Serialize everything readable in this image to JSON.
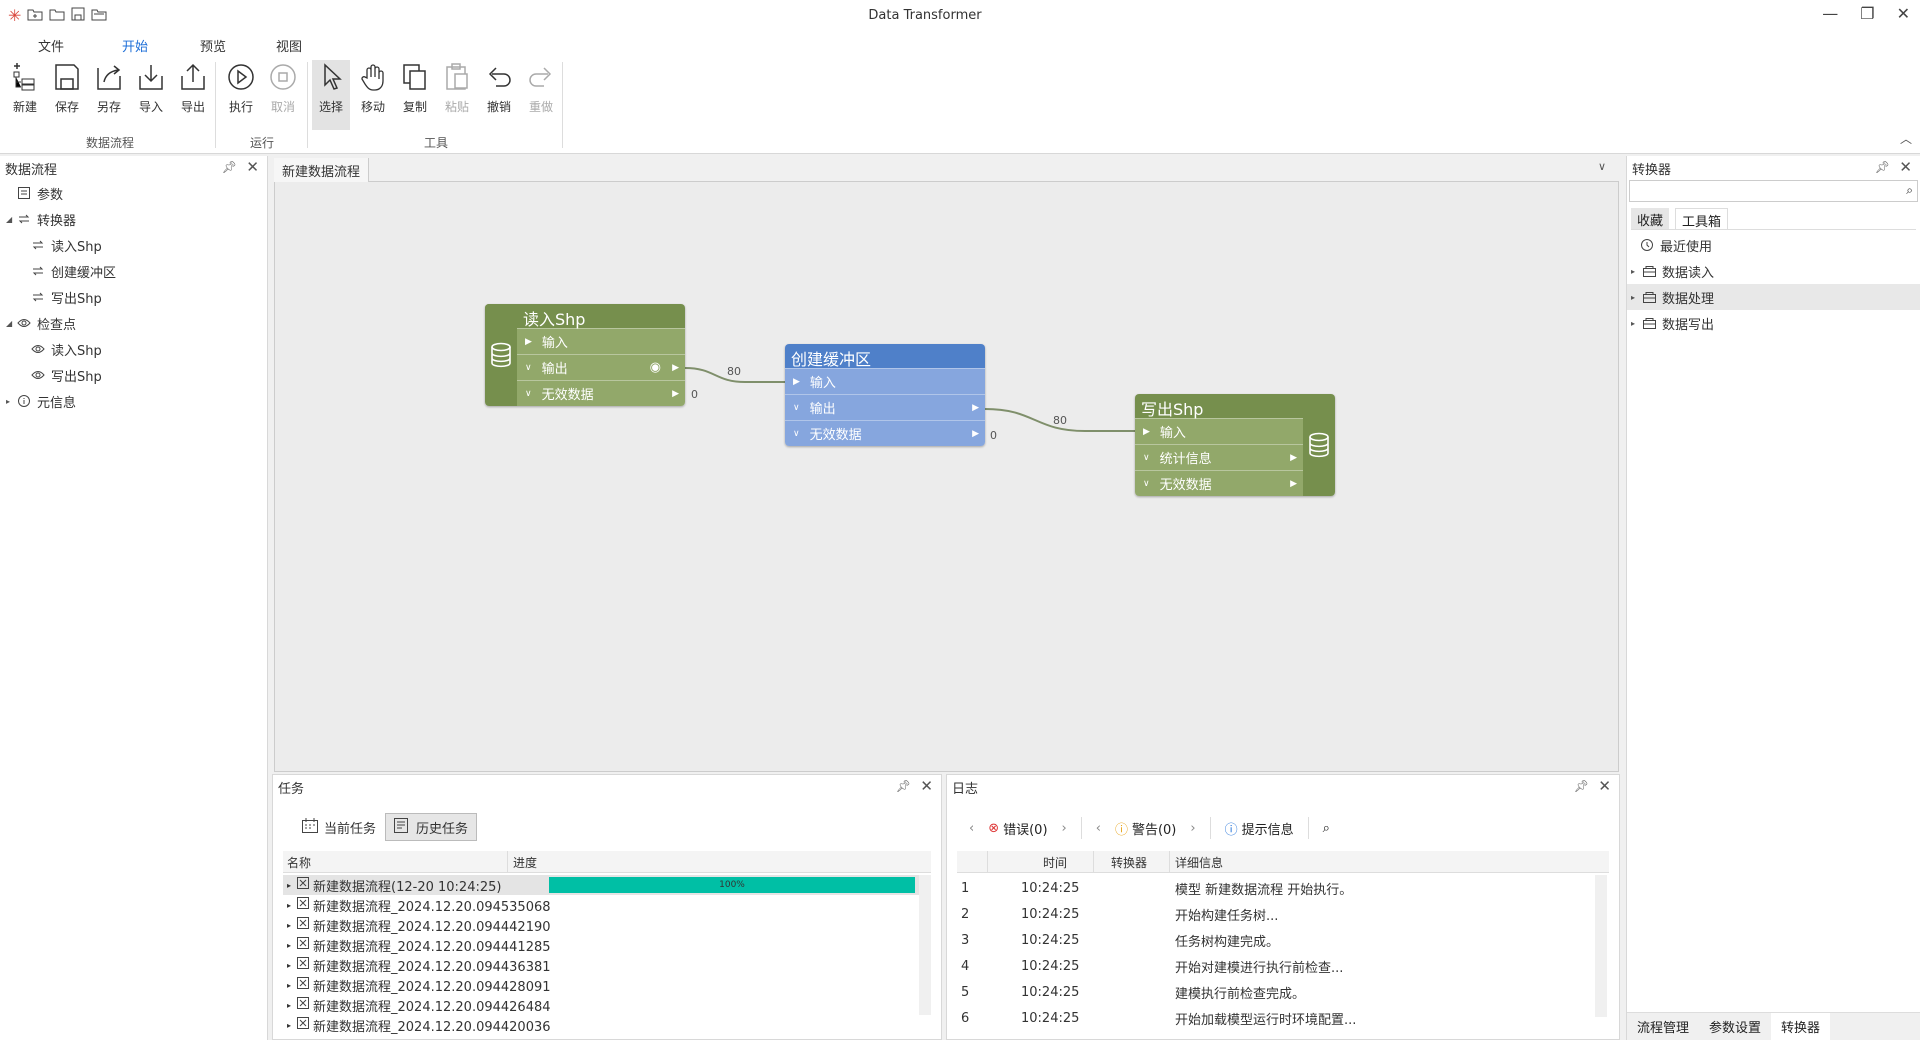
{
  "window": {
    "title": "Data Transformer"
  },
  "menu": {
    "items": [
      "文件",
      "开始",
      "预览",
      "视图"
    ],
    "active": "开始"
  },
  "ribbon": {
    "groups": [
      {
        "label": "数据流程",
        "buttons": [
          "新建",
          "保存",
          "另存",
          "导入",
          "导出"
        ]
      },
      {
        "label": "运行",
        "buttons": [
          "执行",
          "取消"
        ]
      },
      {
        "label": "工具",
        "buttons": [
          "选择",
          "移动",
          "复制",
          "粘贴",
          "撤销",
          "重做"
        ]
      }
    ],
    "disabled": [
      "取消",
      "粘贴",
      "重做"
    ],
    "selected": "选择"
  },
  "left_panel": {
    "title": "数据流程",
    "tree": [
      {
        "label": "参数",
        "level": 0,
        "icon": "params-icon"
      },
      {
        "label": "转换器",
        "level": 0,
        "icon": "transform-icon",
        "expanded": true
      },
      {
        "label": "读入Shp",
        "level": 1,
        "icon": "transform-icon"
      },
      {
        "label": "创建缓冲区",
        "level": 1,
        "icon": "transform-icon"
      },
      {
        "label": "写出Shp",
        "level": 1,
        "icon": "transform-icon"
      },
      {
        "label": "检查点",
        "level": 0,
        "icon": "eye-icon",
        "expanded": true
      },
      {
        "label": "读入Shp",
        "level": 1,
        "icon": "eye-icon"
      },
      {
        "label": "写出Shp",
        "level": 1,
        "icon": "eye-icon"
      },
      {
        "label": "元信息",
        "level": 0,
        "icon": "info-icon",
        "collapsed": true
      }
    ]
  },
  "document_tab": {
    "title": "新建数据流程"
  },
  "nodes": {
    "read": {
      "title": "读入Shp",
      "ports": [
        "输入",
        "输出",
        "无效数据"
      ]
    },
    "buffer": {
      "title": "创建缓冲区",
      "ports": [
        "输入",
        "输出",
        "无效数据"
      ]
    },
    "write": {
      "title": "写出Shp",
      "ports": [
        "输入",
        "统计信息",
        "无效数据"
      ]
    }
  },
  "connections": {
    "read_out": "80",
    "read_invalid": "0",
    "buffer_out": "80",
    "buffer_invalid": "0"
  },
  "right_panel": {
    "title": "转换器",
    "search_placeholder": "",
    "tabs": [
      "收藏",
      "工具箱"
    ],
    "active_tab": "工具箱",
    "items": [
      "最近使用",
      "数据读入",
      "数据处理",
      "数据写出"
    ],
    "selected": "数据处理",
    "bottom_tabs": [
      "流程管理",
      "参数设置",
      "转换器"
    ]
  },
  "task_panel": {
    "title": "任务",
    "tabs": [
      "当前任务",
      "历史任务"
    ],
    "active_tab": "历史任务",
    "columns": [
      "名称",
      "进度"
    ],
    "rows": [
      {
        "name": "新建数据流程(12-20 10:24:25)",
        "progress": "100%"
      },
      {
        "name": "新建数据流程_2024.12.20.094535068"
      },
      {
        "name": "新建数据流程_2024.12.20.094442190"
      },
      {
        "name": "新建数据流程_2024.12.20.094441285"
      },
      {
        "name": "新建数据流程_2024.12.20.094436381"
      },
      {
        "name": "新建数据流程_2024.12.20.094428091"
      },
      {
        "name": "新建数据流程_2024.12.20.094426484"
      },
      {
        "name": "新建数据流程_2024.12.20.094420036"
      }
    ]
  },
  "log_panel": {
    "title": "日志",
    "error_label": "错误(0)",
    "warning_label": "警告(0)",
    "info_label": "提示信息",
    "columns": [
      "时间",
      "转换器",
      "详细信息"
    ],
    "rows": [
      {
        "n": "1",
        "time": "10:24:25",
        "detail": "模型 新建数据流程 开始执行。"
      },
      {
        "n": "2",
        "time": "10:24:25",
        "detail": "开始构建任务树..."
      },
      {
        "n": "3",
        "time": "10:24:25",
        "detail": "任务树构建完成。"
      },
      {
        "n": "4",
        "time": "10:24:25",
        "detail": "开始对建模进行执行前检查..."
      },
      {
        "n": "5",
        "time": "10:24:25",
        "detail": "建模执行前检查完成。"
      },
      {
        "n": "6",
        "time": "10:24:25",
        "detail": "开始加载模型运行时环境配置..."
      }
    ]
  },
  "colors": {
    "accent": "#1e6fd8",
    "progress": "#00bfa5",
    "node_green": "#768f4d",
    "node_blue": "#4f80c9"
  }
}
